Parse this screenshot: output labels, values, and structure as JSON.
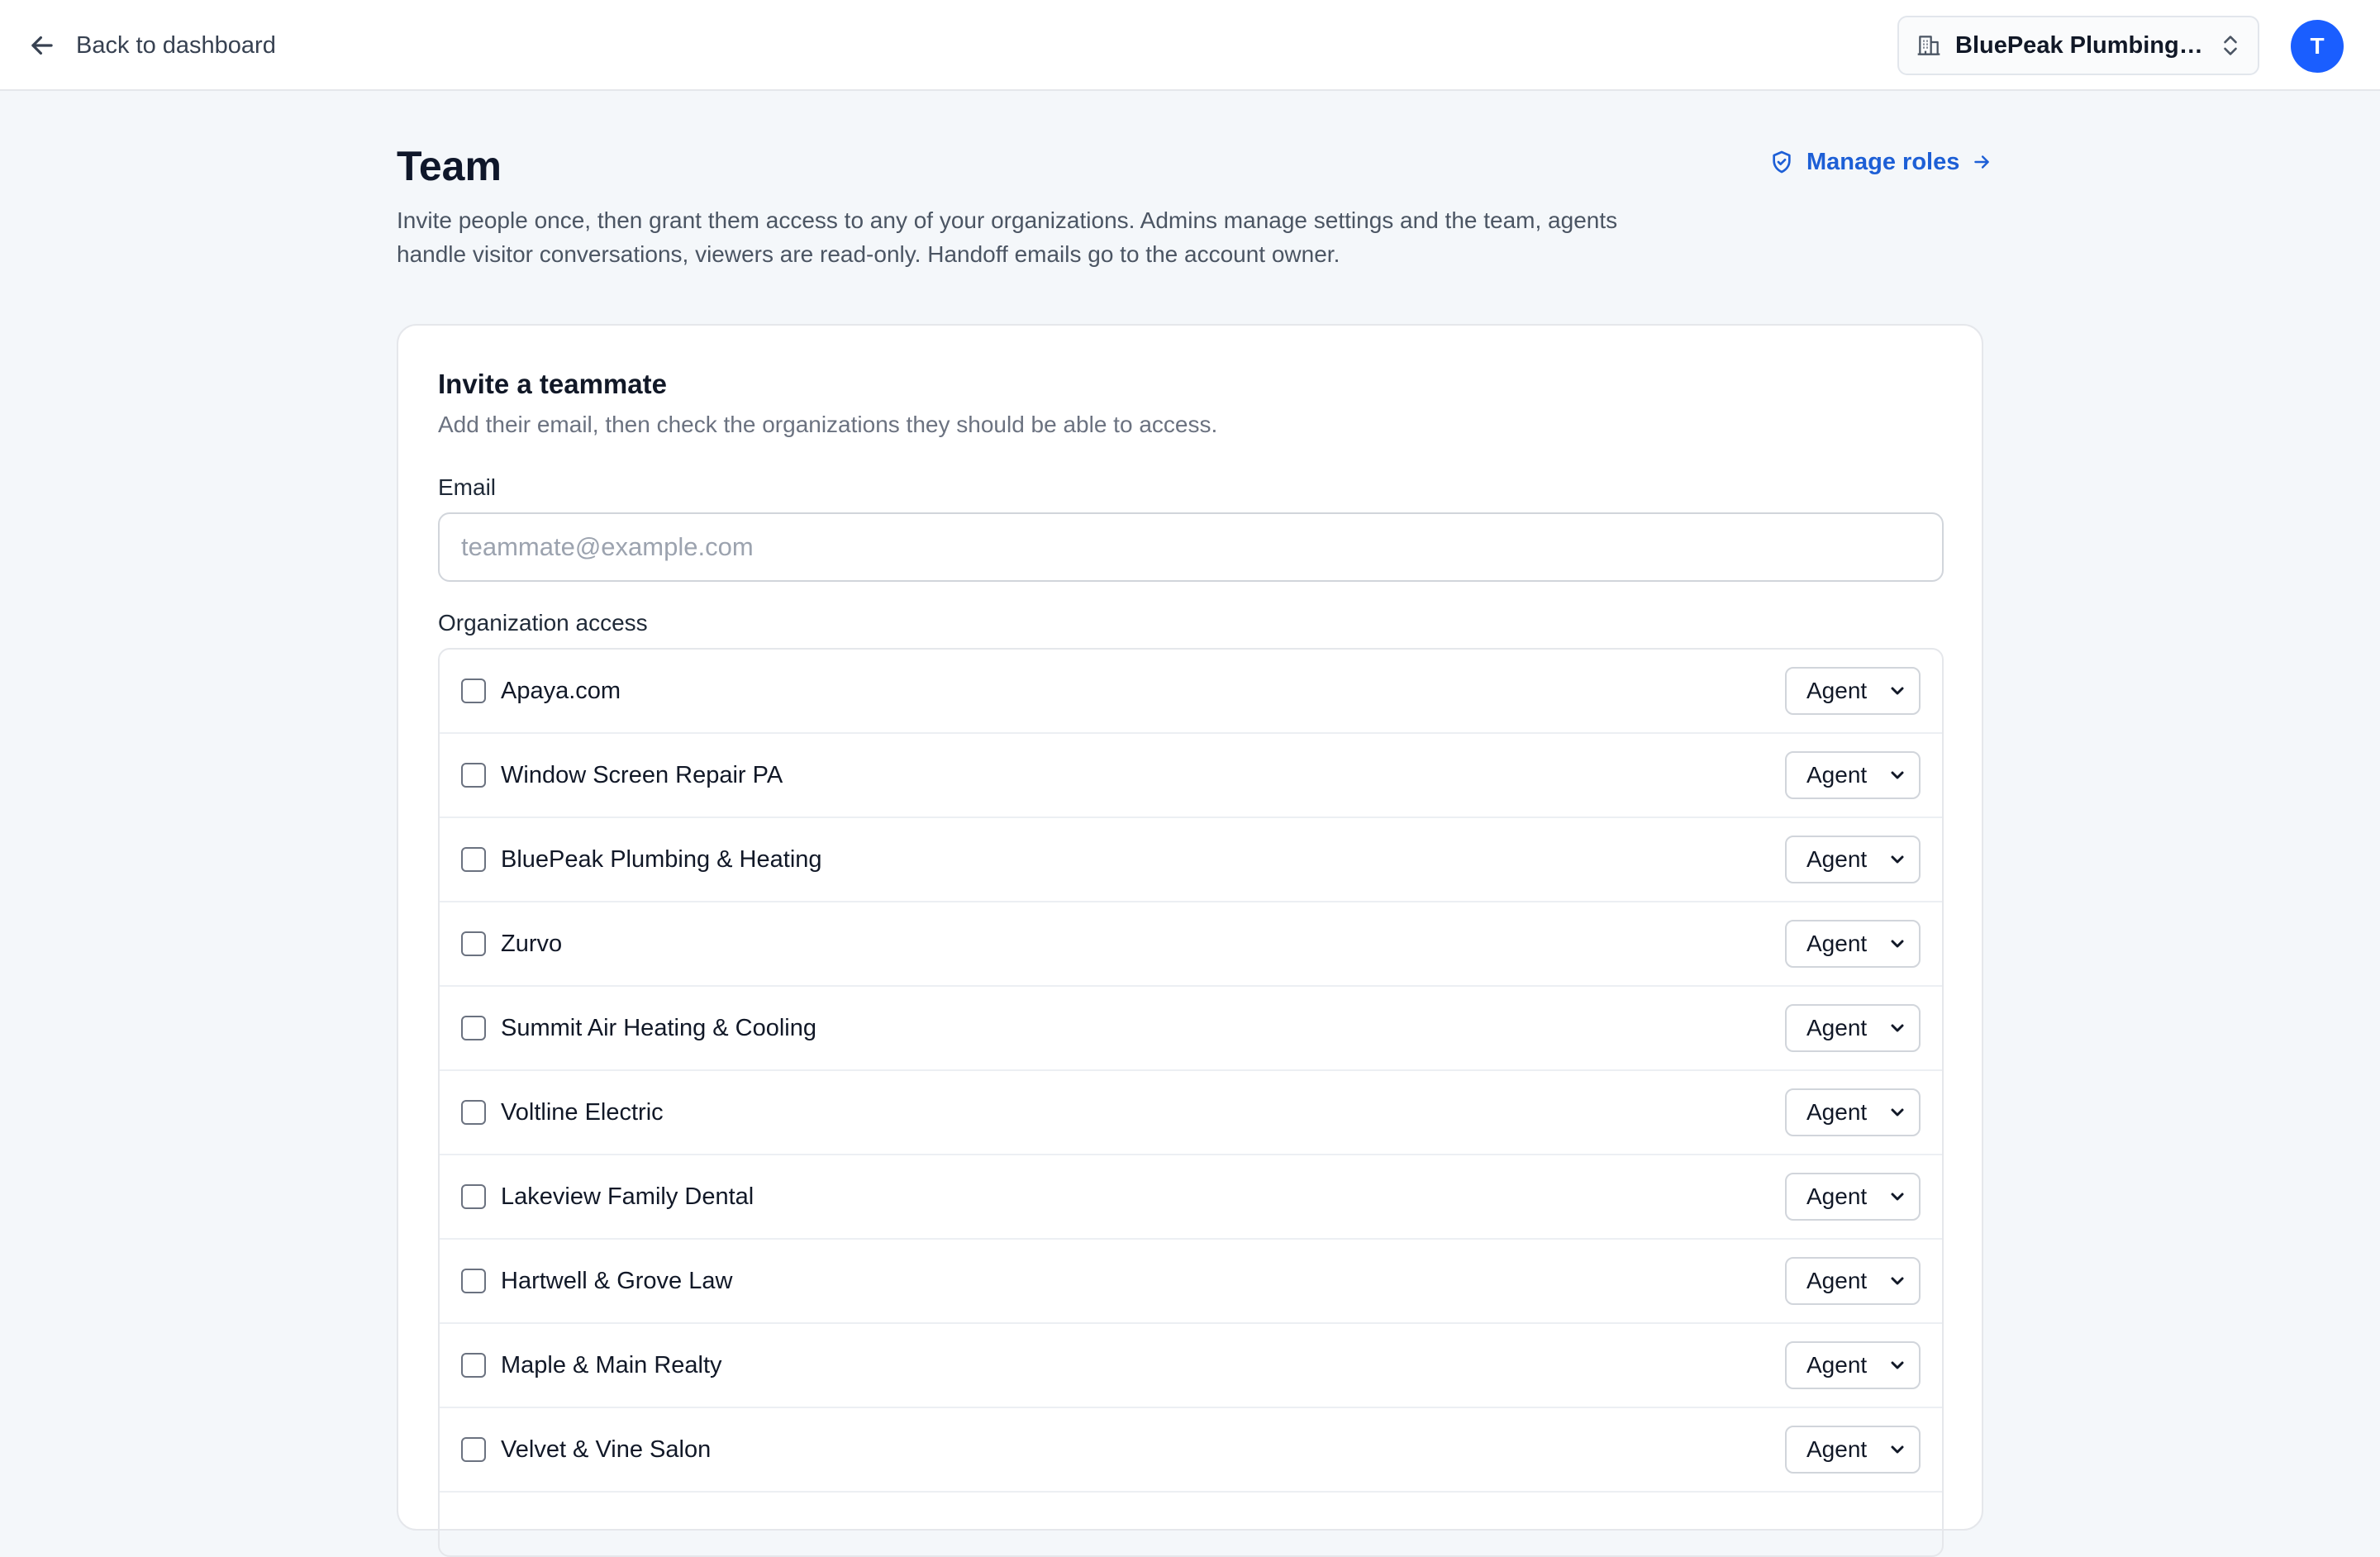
{
  "header": {
    "back_label": "Back to dashboard",
    "org_switcher_label": "BluePeak Plumbing & Heating",
    "avatar_initial": "T"
  },
  "page": {
    "title": "Team",
    "manage_roles_label": "Manage roles",
    "description": "Invite people once, then grant them access to any of your organizations. Admins manage settings and the team, agents handle visitor conversations, viewers are read-only. Handoff emails go to the account owner."
  },
  "invite": {
    "title": "Invite a teammate",
    "subtitle": "Add their email, then check the organizations they should be able to access.",
    "email_label": "Email",
    "email_placeholder": "teammate@example.com",
    "email_value": "",
    "org_access_label": "Organization access",
    "organizations": [
      {
        "name": "Apaya.com",
        "role": "Agent",
        "checked": false
      },
      {
        "name": "Window Screen Repair PA",
        "role": "Agent",
        "checked": false
      },
      {
        "name": "BluePeak Plumbing & Heating",
        "role": "Agent",
        "checked": false
      },
      {
        "name": "Zurvo",
        "role": "Agent",
        "checked": false
      },
      {
        "name": "Summit Air Heating & Cooling",
        "role": "Agent",
        "checked": false
      },
      {
        "name": "Voltline Electric",
        "role": "Agent",
        "checked": false
      },
      {
        "name": "Lakeview Family Dental",
        "role": "Agent",
        "checked": false
      },
      {
        "name": "Hartwell & Grove Law",
        "role": "Agent",
        "checked": false
      },
      {
        "name": "Maple & Main Realty",
        "role": "Agent",
        "checked": false
      },
      {
        "name": "Velvet & Vine Salon",
        "role": "Agent",
        "checked": false
      }
    ]
  },
  "colors": {
    "accent": "#1d5fd6",
    "avatar_bg": "#1a5eff",
    "page_bg": "#f4f7fa"
  },
  "icons": {
    "back": "arrow-left-icon",
    "org_switcher": "building-icon",
    "org_switcher_toggle": "chevron-up-down-icon",
    "manage_roles": "shield-check-icon",
    "manage_roles_arrow": "arrow-right-icon",
    "role_dropdown": "chevron-down-icon"
  }
}
